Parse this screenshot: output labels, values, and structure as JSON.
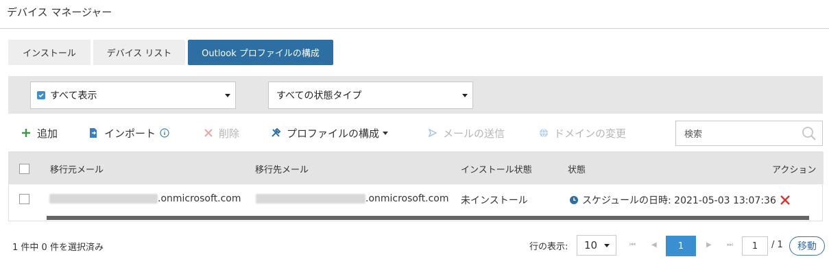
{
  "page": {
    "title": "デバイス マネージャー"
  },
  "tabs": [
    {
      "label": "インストール"
    },
    {
      "label": "デバイス リスト"
    },
    {
      "label": "Outlook プロファイルの構成"
    }
  ],
  "filters": {
    "show": "すべて表示",
    "state_type": "すべての状態タイプ"
  },
  "toolbar": {
    "add": "追加",
    "import": "インポート",
    "delete": "削除",
    "configure_profile": "プロファイルの構成",
    "send_mail": "メールの送信",
    "change_domain": "ドメインの変更",
    "search_placeholder": "検索"
  },
  "table": {
    "headers": {
      "source_mail": "移行元メール",
      "target_mail": "移行先メール",
      "install_state": "インストール状態",
      "state": "状態",
      "action": "アクション"
    },
    "rows": [
      {
        "source_mail": ".onmicrosoft.com",
        "target_mail": ".onmicrosoft.com",
        "install_state": "未インストール",
        "state": "スケジュールの日時: 2021-05-03 13:07:36"
      }
    ]
  },
  "footer": {
    "selection": "1 件中 0 件を選択済み",
    "rows_label": "行の表示:",
    "rows_per_page": "10",
    "current_page": "1",
    "page_input": "1",
    "total_pages": "/ 1",
    "move": "移動"
  },
  "colors": {
    "active_tab": "#2d6fa3",
    "active_page": "#3a8fd1",
    "delete_red": "#d9342b",
    "add_green": "#3a9a4a"
  }
}
